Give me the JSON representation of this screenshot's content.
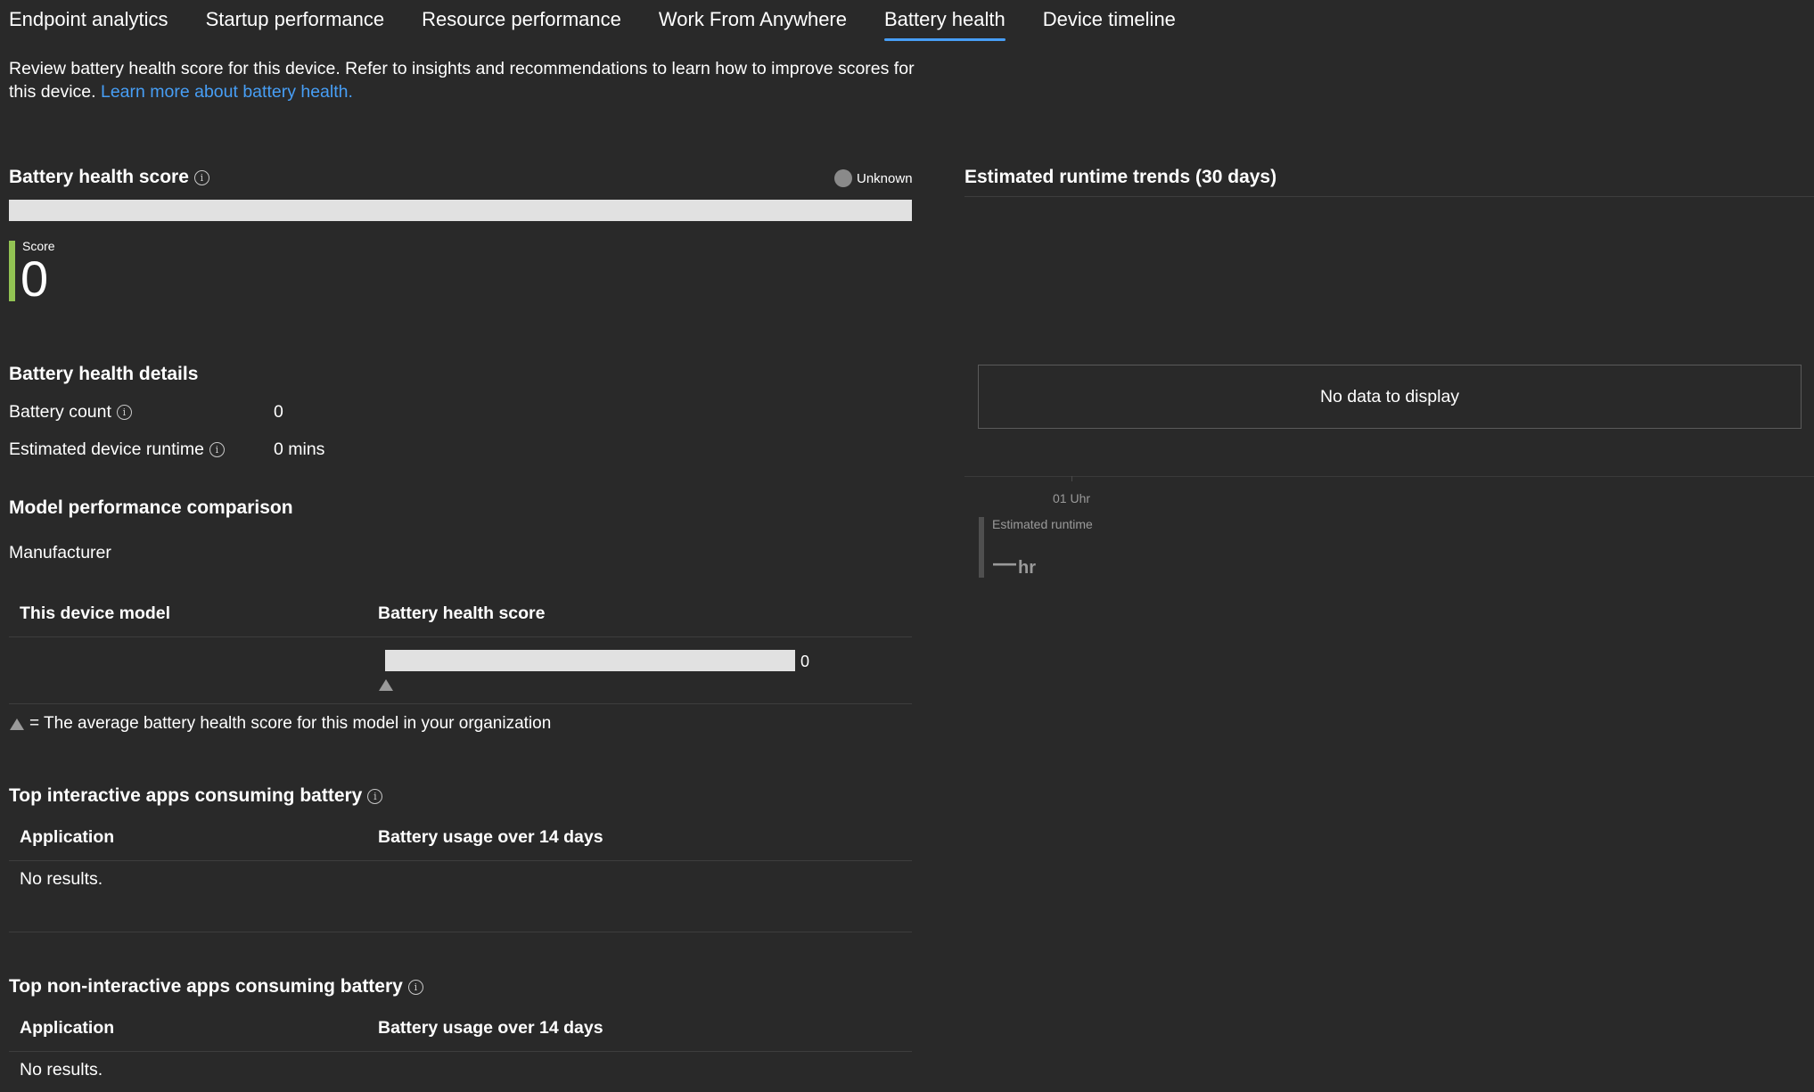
{
  "tabs": [
    {
      "label": "Endpoint analytics"
    },
    {
      "label": "Startup performance"
    },
    {
      "label": "Resource performance"
    },
    {
      "label": "Work From Anywhere"
    },
    {
      "label": "Battery health",
      "active": true
    },
    {
      "label": "Device timeline"
    }
  ],
  "description": {
    "text": "Review battery health score for this device. Refer to insights and recommendations to learn how to improve scores for this device.",
    "link": "Learn more about battery health."
  },
  "score_card": {
    "title": "Battery health score",
    "status": "Unknown",
    "score_label": "Score",
    "score_value": "0",
    "score_fraction": 0,
    "accent_color": "#92c353"
  },
  "details": {
    "title": "Battery health details",
    "rows": [
      {
        "label": "Battery count",
        "value": "0"
      },
      {
        "label": "Estimated device runtime",
        "value": "0 mins"
      }
    ]
  },
  "model_comparison": {
    "title": "Model performance comparison",
    "subtitle": "Manufacturer",
    "col_model": "This device model",
    "col_score": "Battery health score",
    "bar_value": "0",
    "legend": "= The average battery health score for this model in your organization"
  },
  "interactive_apps": {
    "title": "Top interactive apps consuming battery",
    "col_app": "Application",
    "col_usage": "Battery usage over 14 days",
    "empty": "No results."
  },
  "noninteractive_apps": {
    "title": "Top non-interactive apps consuming battery",
    "col_app": "Application",
    "col_usage": "Battery usage over 14 days",
    "empty": "No results."
  },
  "trends": {
    "title": "Estimated runtime trends (30 days)",
    "no_data": "No data to display",
    "x_tick": "01 Uhr",
    "legend_label": "Estimated runtime",
    "legend_value": "—",
    "legend_unit": "hr"
  }
}
